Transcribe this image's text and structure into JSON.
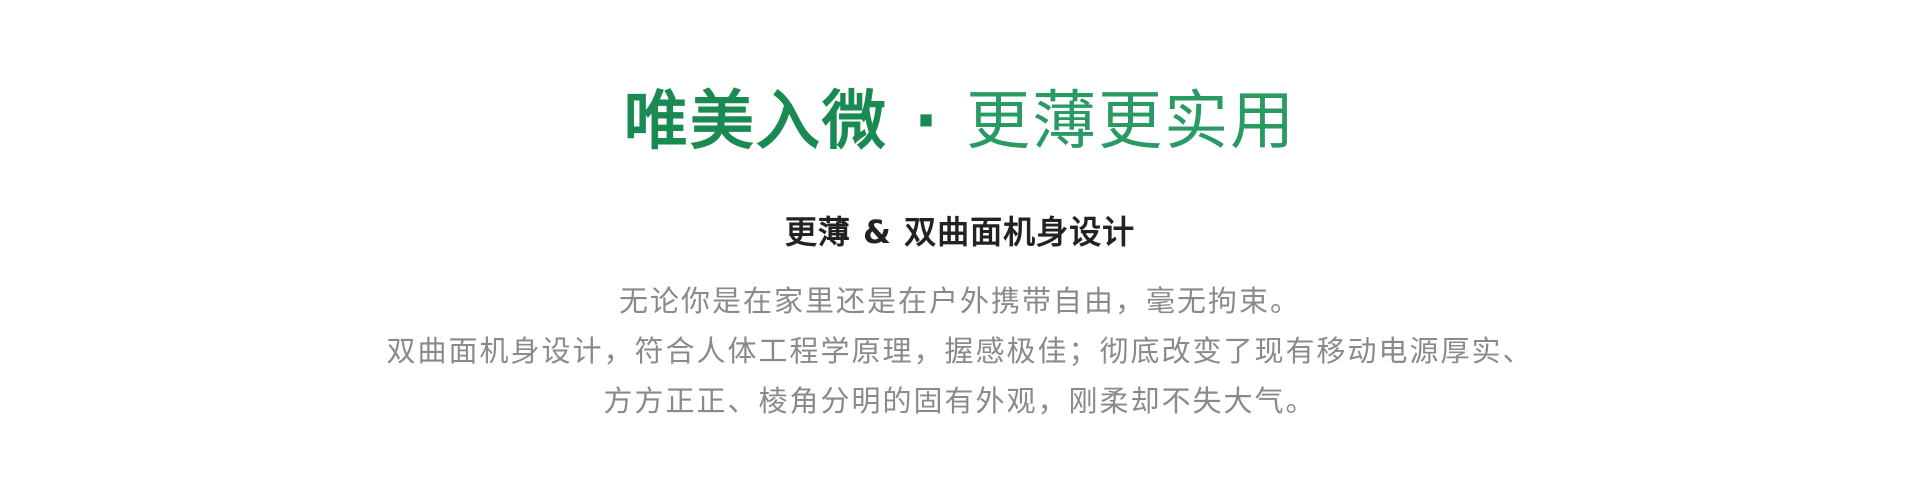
{
  "headline": {
    "bold_part": "唯美入微",
    "separator": "·",
    "light_part": "更薄更实用"
  },
  "subtitle": "更薄 & 双曲面机身设计",
  "description": {
    "lines": [
      "无论你是在家里还是在户外携带自由，毫无拘束。",
      "双曲面机身设计，符合人体工程学原理，握感极佳；彻底改变了现有移动电源厚实、",
      "方方正正、棱角分明的固有外观，刚柔却不失大气。"
    ]
  },
  "colors": {
    "headline_green": "#1a8a53",
    "subtitle": "#222222",
    "body": "#8a8a8a",
    "background": "#ffffff"
  }
}
